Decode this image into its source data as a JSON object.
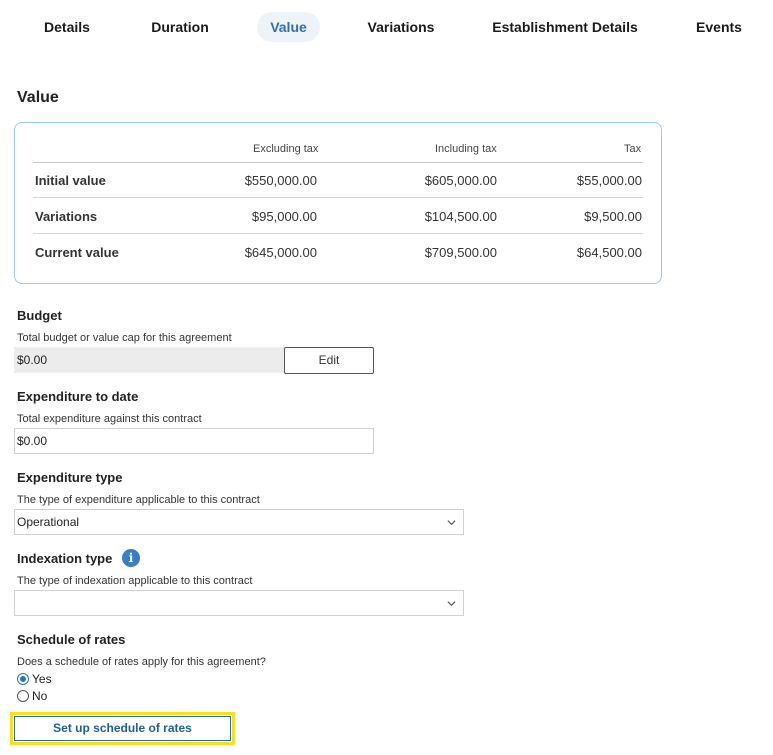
{
  "tabs": [
    {
      "label": "Details"
    },
    {
      "label": "Duration"
    },
    {
      "label": "Value"
    },
    {
      "label": "Variations"
    },
    {
      "label": "Establishment Details"
    },
    {
      "label": "Events"
    }
  ],
  "active_tab": "Value",
  "section_title": "Value",
  "value_table": {
    "headers": [
      "Excluding tax",
      "Including tax",
      "Tax"
    ],
    "rows": [
      {
        "label": "Initial value",
        "excluding": "$550,000.00",
        "including": "$605,000.00",
        "tax": "$55,000.00"
      },
      {
        "label": "Variations",
        "excluding": "$95,000.00",
        "including": "$104,500.00",
        "tax": "$9,500.00"
      },
      {
        "label": "Current value",
        "excluding": "$645,000.00",
        "including": "$709,500.00",
        "tax": "$64,500.00"
      }
    ]
  },
  "budget": {
    "title": "Budget",
    "help": "Total budget or value cap for this agreement",
    "value": "$0.00",
    "edit_label": "Edit"
  },
  "expenditure": {
    "title": "Expenditure to date",
    "help": "Total expenditure against this contract",
    "value": "$0.00"
  },
  "expenditure_type": {
    "title": "Expenditure type",
    "help": "The type of expenditure applicable to this contract",
    "selected": "Operational"
  },
  "indexation_type": {
    "title": "Indexation type",
    "help": "The type of indexation applicable to this contract",
    "selected": "",
    "info_glyph": "i"
  },
  "schedule": {
    "title": "Schedule of rates",
    "question": "Does a schedule of rates apply for this agreement?",
    "options": [
      {
        "label": "Yes",
        "checked": true
      },
      {
        "label": "No",
        "checked": false
      }
    ],
    "button_label": "Set up schedule of rates"
  },
  "colors": {
    "accent": "#2f6fb0",
    "card_border": "#9fc6e6",
    "highlight": "#f3e21c"
  }
}
